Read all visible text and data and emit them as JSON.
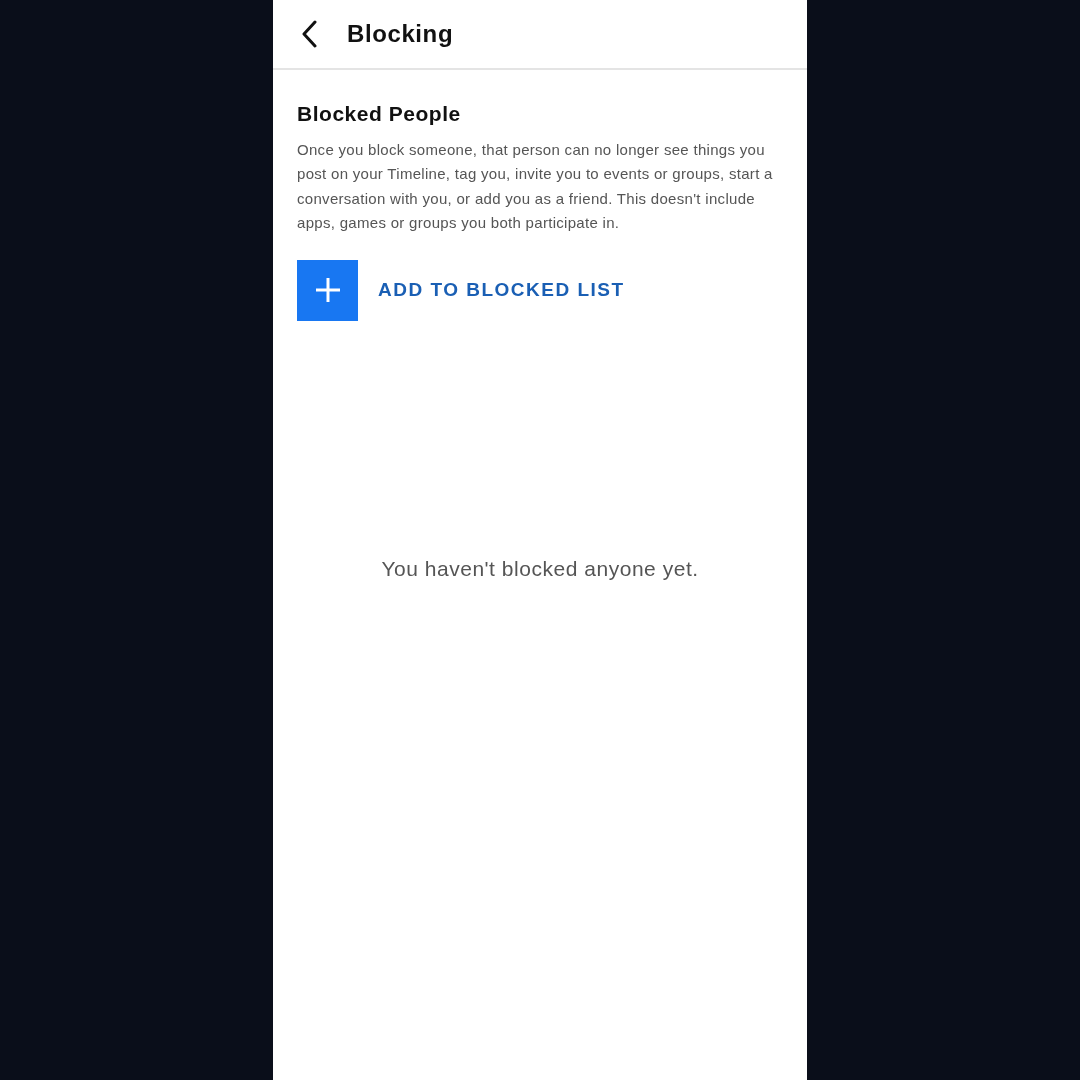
{
  "header": {
    "title": "Blocking"
  },
  "section": {
    "heading": "Blocked People",
    "description": "Once you block someone, that person can no longer see things you post on your Timeline, tag you, invite you to events or groups, start a conversation with you, or add you as a friend. This doesn't include apps, games or groups you both participate in."
  },
  "add_button": {
    "label": "ADD TO BLOCKED LIST"
  },
  "empty_state": "You haven't blocked anyone yet."
}
